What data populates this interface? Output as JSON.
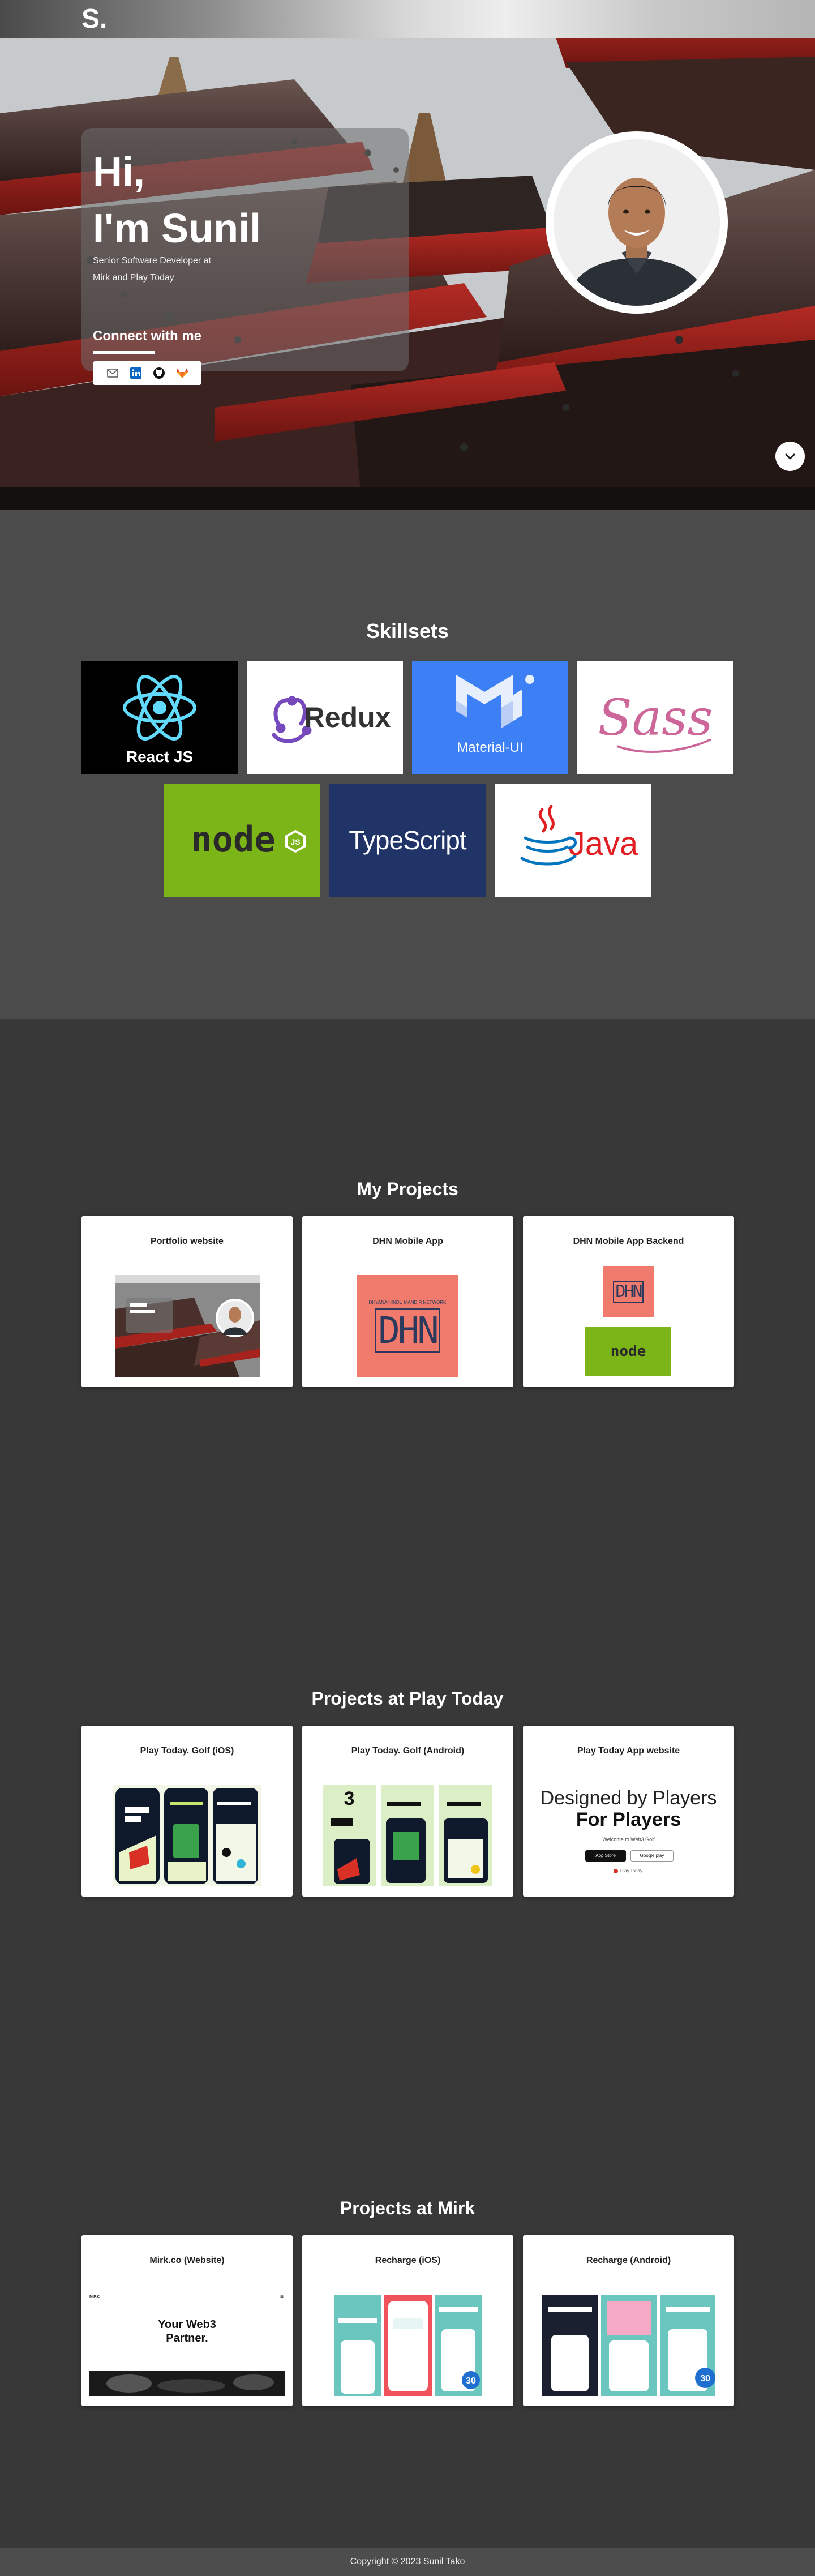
{
  "header": {
    "logo": "S."
  },
  "hero": {
    "greeting": "Hi,",
    "name_line": "I'm Sunil",
    "subtitle": "Senior Software Developer at Mirk and Play Today",
    "connect_heading": "Connect with me",
    "social_icons": [
      "mail-icon",
      "linkedin-icon",
      "github-icon",
      "gitlab-icon"
    ],
    "scroll_icon": "chevron-down-icon"
  },
  "skills": {
    "title": "Skillsets",
    "items": [
      {
        "name": "React JS",
        "bg": "#000000"
      },
      {
        "name": "Redux",
        "bg": "#ffffff"
      },
      {
        "name": "Material-UI",
        "bg": "#3d7ff5"
      },
      {
        "name": "Sass",
        "bg": "#ffffff"
      },
      {
        "name": "node",
        "bg": "#7cb518"
      },
      {
        "name": "TypeScript",
        "bg": "#213468"
      },
      {
        "name": "Java",
        "bg": "#ffffff"
      }
    ]
  },
  "my_projects": {
    "title": "My Projects",
    "cards": [
      {
        "title": "Portfolio website"
      },
      {
        "title": "DHN Mobile App",
        "logo_text": "DHN",
        "logo_caption": "DHYANA HINDU MANDIR NETWORK"
      },
      {
        "title": "DHN Mobile App Backend",
        "logo_text": "DHN",
        "node_text": "node"
      }
    ]
  },
  "play_today": {
    "title": "Projects at Play Today",
    "cards": [
      {
        "title": "Play Today. Golf (iOS)"
      },
      {
        "title": "Play Today. Golf (Android)"
      },
      {
        "title": "Play Today App website",
        "headline_1": "Designed by Players",
        "headline_2": "For Players",
        "welcome": "Welcome to Web3 Golf",
        "store_1": "App Store",
        "store_2": "Google play",
        "tag": "Play Today"
      }
    ]
  },
  "mirk": {
    "title": "Projects at Mirk",
    "cards": [
      {
        "title": "Mirk.co (Website)",
        "brand": "MIRK",
        "headline_1": "Your Web3",
        "headline_2": "Partner."
      },
      {
        "title": "Recharge (iOS)",
        "badge": "30"
      },
      {
        "title": "Recharge (Android)",
        "badge": "30"
      }
    ]
  },
  "footer": {
    "copyright": "Copyright © 2023 Sunil Tako"
  },
  "colors": {
    "page_bg": "#383838",
    "skills_bg": "#4b4b4b",
    "footer_bg": "#4d4d4d",
    "dhn_salmon": "#f07a6c",
    "dhn_navy": "#2b3a5c",
    "node_green": "#7cb518"
  }
}
